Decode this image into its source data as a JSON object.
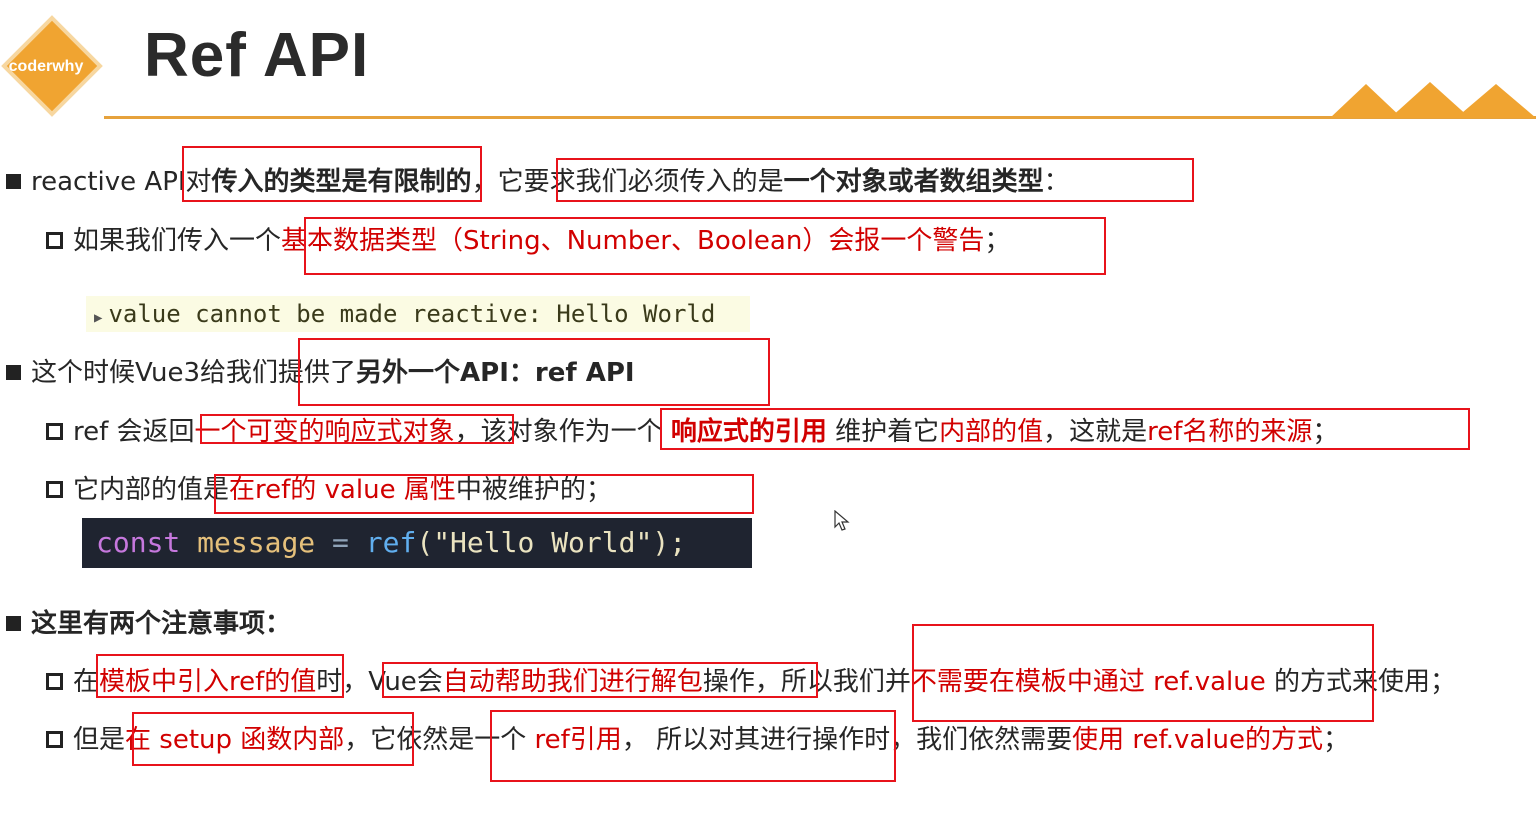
{
  "logo_text": "coderwhy",
  "title": "Ref API",
  "colors": {
    "accent": "#e6a23c",
    "highlight": "#d10000",
    "box": "#e8131b"
  },
  "lines": {
    "l1": {
      "a": "reactive API对",
      "b": "传入的类型是有限制的",
      "c": "，它要求我们必须传入的是",
      "d": "一个对象或者数组类型",
      "e": "："
    },
    "l2": {
      "a": "如果我们传入一个",
      "b": "基本数据类型（String、Number、Boolean）会报一个警告",
      "c": "；"
    },
    "warning": "value cannot be made reactive: Hello World",
    "l3": {
      "a": "这个时候Vue3给我们提供了",
      "b": "另外一个API：ref API"
    },
    "l4": {
      "a": "ref 会返回",
      "b": "一个可变的响应式对象",
      "c": "，该对象作为一个 ",
      "d": "响应式的引用",
      "e": " 维护着它",
      "f": "内部的值",
      "g": "，这就是",
      "h": "ref名称的来源",
      "i": "；"
    },
    "l5": {
      "a": "它内部的值是",
      "b": "在ref的 value 属性",
      "c": "中被维护的；"
    },
    "code": {
      "kw": "const",
      "name": "message",
      "op": "=",
      "fn": "ref",
      "open": "(",
      "str": "\"Hello World\"",
      "close": ");"
    },
    "l6": {
      "a": "这里有两个注意事项："
    },
    "l7": {
      "a": "在",
      "b": "模板中引入ref的值",
      "c": "时，Vue会",
      "d": "自动帮助我们进行解包",
      "e": "操作，所以我们并",
      "f": "不需要在模板中通过 ref.value",
      "g": " 的方式来使用；"
    },
    "l8": {
      "a": "但是",
      "b": "在 setup 函数内部",
      "c": "，它依然是一个 ",
      "d": "ref引用",
      "e": "， 所以对其进行操作时，我们依然需要",
      "f": "使用 ref.value的方式",
      "g": "；"
    }
  }
}
